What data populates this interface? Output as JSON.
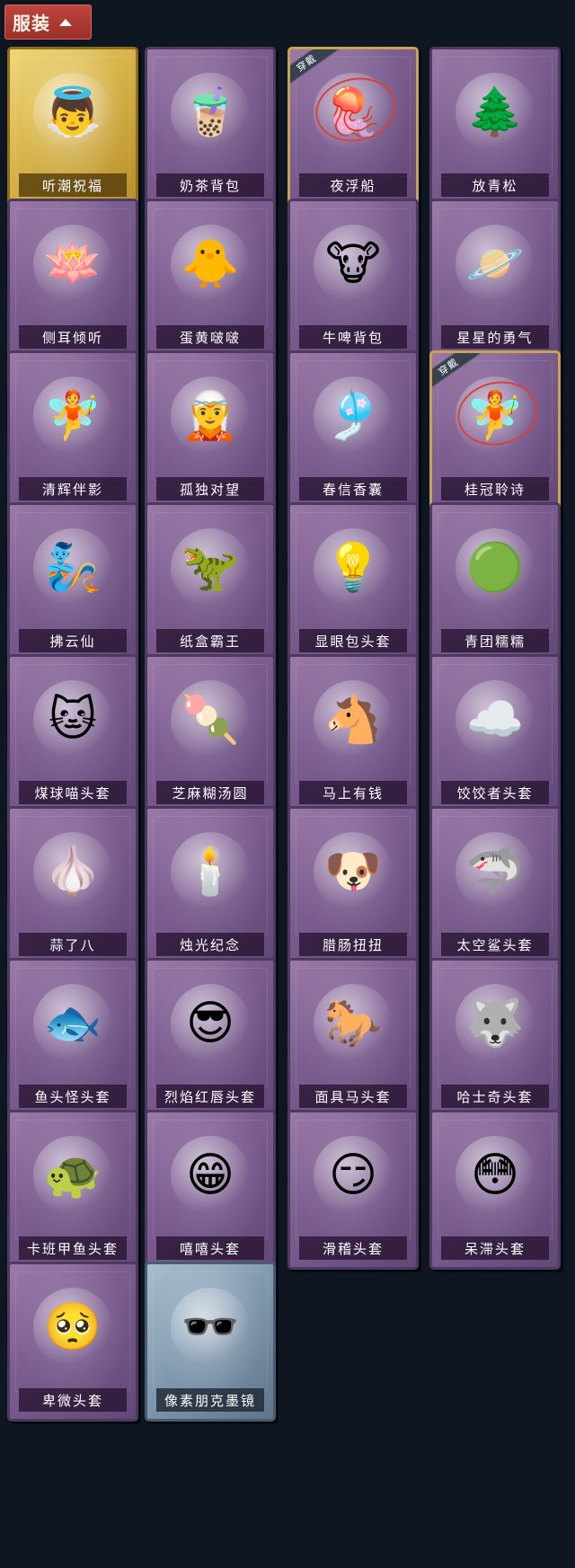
{
  "header": {
    "category_label": "服装"
  },
  "badges": {
    "worn": "穿戴"
  },
  "items": [
    {
      "name": "听潮祝福",
      "icon": "angel-wings-figure-icon",
      "glyph": "👼",
      "rarity": "gold",
      "worn": false
    },
    {
      "name": "奶茶背包",
      "icon": "milk-tea-backpack-icon",
      "glyph": "🧋",
      "rarity": "purple",
      "worn": false
    },
    {
      "name": "夜浮船",
      "icon": "jellyfish-ship-icon",
      "glyph": "🪼",
      "rarity": "purple",
      "worn": true
    },
    {
      "name": "放青松",
      "icon": "potted-pine-icon",
      "glyph": "🌲",
      "rarity": "purple",
      "worn": false
    },
    {
      "name": "侧耳倾听",
      "icon": "flower-wreath-icon",
      "glyph": "🪷",
      "rarity": "purple",
      "worn": false
    },
    {
      "name": "蛋黄啵啵",
      "icon": "yolk-chick-icon",
      "glyph": "🐥",
      "rarity": "purple",
      "worn": false
    },
    {
      "name": "牛啤背包",
      "icon": "cow-beer-barrel-icon",
      "glyph": "🐮",
      "rarity": "purple",
      "worn": false
    },
    {
      "name": "星星的勇气",
      "icon": "star-prince-charm-icon",
      "glyph": "🪐",
      "rarity": "purple",
      "worn": false
    },
    {
      "name": "清辉伴影",
      "icon": "moon-spirit-charm-icon",
      "glyph": "🧚",
      "rarity": "purple",
      "worn": false
    },
    {
      "name": "孤独对望",
      "icon": "lonely-doll-charm-icon",
      "glyph": "🧝",
      "rarity": "purple",
      "worn": false
    },
    {
      "name": "春信香囊",
      "icon": "sachet-icon",
      "glyph": "🎐",
      "rarity": "purple",
      "worn": false
    },
    {
      "name": "桂冠聆诗",
      "icon": "laurel-poet-charm-icon",
      "glyph": "🧚",
      "rarity": "purple",
      "worn": true
    },
    {
      "name": "拂云仙",
      "icon": "cloud-immortal-charm-icon",
      "glyph": "🧞",
      "rarity": "purple",
      "worn": false
    },
    {
      "name": "纸盒霸王",
      "icon": "box-dinosaur-icon",
      "glyph": "🦖",
      "rarity": "purple",
      "worn": false
    },
    {
      "name": "显眼包头套",
      "icon": "lightbulb-head-icon",
      "glyph": "💡",
      "rarity": "purple",
      "worn": false
    },
    {
      "name": "青团糯糯",
      "icon": "green-rice-ball-icon",
      "glyph": "🟢",
      "rarity": "purple",
      "worn": false
    },
    {
      "name": "煤球喵头套",
      "icon": "black-cat-head-icon",
      "glyph": "🐱",
      "rarity": "purple",
      "worn": false
    },
    {
      "name": "芝麻糊汤圆",
      "icon": "rice-dumpling-icon",
      "glyph": "🍡",
      "rarity": "purple",
      "worn": false
    },
    {
      "name": "马上有钱",
      "icon": "horse-head-icon",
      "glyph": "🐴",
      "rarity": "purple",
      "worn": false
    },
    {
      "name": "饺饺者头套",
      "icon": "cloud-dumpling-head-icon",
      "glyph": "☁️",
      "rarity": "purple",
      "worn": false
    },
    {
      "name": "蒜了八",
      "icon": "garlic-head-icon",
      "glyph": "🧄",
      "rarity": "purple",
      "worn": false
    },
    {
      "name": "烛光纪念",
      "icon": "candle-head-icon",
      "glyph": "🕯️",
      "rarity": "purple",
      "worn": false
    },
    {
      "name": "腊肠扭扭",
      "icon": "dachshund-head-icon",
      "glyph": "🐶",
      "rarity": "purple",
      "worn": false
    },
    {
      "name": "太空鲨头套",
      "icon": "space-shark-head-icon",
      "glyph": "🦈",
      "rarity": "purple",
      "worn": false
    },
    {
      "name": "鱼头怪头套",
      "icon": "fish-head-mask-icon",
      "glyph": "🐟",
      "rarity": "purple",
      "worn": false
    },
    {
      "name": "烈焰红唇头套",
      "icon": "yellow-mouse-sunglasses-icon",
      "glyph": "😎",
      "rarity": "purple",
      "worn": false
    },
    {
      "name": "面具马头套",
      "icon": "horse-mask-icon",
      "glyph": "🐎",
      "rarity": "purple",
      "worn": false
    },
    {
      "name": "哈士奇头套",
      "icon": "husky-sunglasses-icon",
      "glyph": "🐺",
      "rarity": "purple",
      "worn": false
    },
    {
      "name": "卡班甲鱼头套",
      "icon": "turtle-head-icon",
      "glyph": "🐢",
      "rarity": "purple",
      "worn": false
    },
    {
      "name": "嘻嘻头套",
      "icon": "grinning-emoji-head-icon",
      "glyph": "😁",
      "rarity": "purple",
      "worn": false
    },
    {
      "name": "滑稽头套",
      "icon": "smirk-emoji-head-icon",
      "glyph": "😏",
      "rarity": "purple",
      "worn": false
    },
    {
      "name": "呆滞头套",
      "icon": "dazed-emoji-head-icon",
      "glyph": "😳",
      "rarity": "purple",
      "worn": false
    },
    {
      "name": "卑微头套",
      "icon": "pleading-emoji-head-icon",
      "glyph": "🥺",
      "rarity": "purple",
      "worn": false
    },
    {
      "name": "像素朋克墨镜",
      "icon": "pixel-sunglasses-icon",
      "glyph": "🕶️",
      "rarity": "silver",
      "worn": false
    }
  ]
}
